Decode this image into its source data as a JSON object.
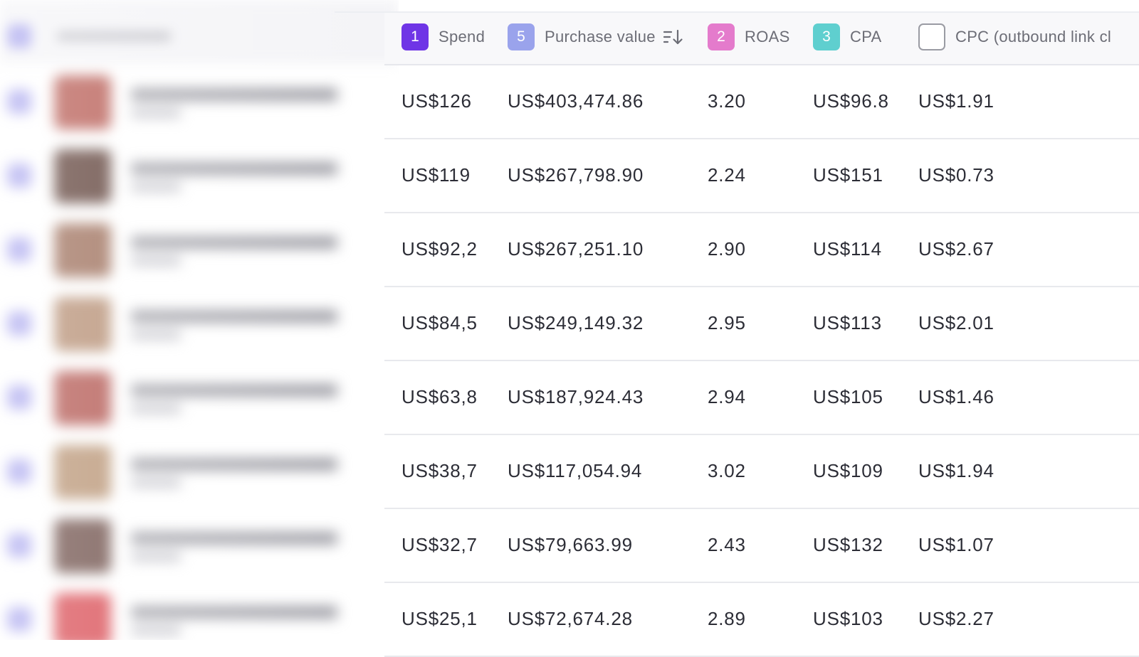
{
  "columns": [
    {
      "badge": "1",
      "label": "Spend",
      "color": "#6f35e6"
    },
    {
      "badge": "5",
      "label": "Purchase value",
      "color": "#9aa3ec",
      "sort_icon": "sort-descending-icon"
    },
    {
      "badge": "2",
      "label": "ROAS",
      "color": "#e47bcc"
    },
    {
      "badge": "3",
      "label": "CPA",
      "color": "#5fcfcf"
    },
    {
      "badge": "",
      "label": "CPC (outbound link cl",
      "color": "#ffffff"
    }
  ],
  "rows": [
    {
      "spend": "US$126",
      "purchase_value": "US$403,474.86",
      "roas": "3.20",
      "cpa": "US$96.8",
      "cpc": "US$1.91"
    },
    {
      "spend": "US$119",
      "purchase_value": "US$267,798.90",
      "roas": "2.24",
      "cpa": "US$151",
      "cpc": "US$0.73"
    },
    {
      "spend": "US$92,2",
      "purchase_value": "US$267,251.10",
      "roas": "2.90",
      "cpa": "US$114",
      "cpc": "US$2.67"
    },
    {
      "spend": "US$84,5",
      "purchase_value": "US$249,149.32",
      "roas": "2.95",
      "cpa": "US$113",
      "cpc": "US$2.01"
    },
    {
      "spend": "US$63,8",
      "purchase_value": "US$187,924.43",
      "roas": "2.94",
      "cpa": "US$105",
      "cpc": "US$1.46"
    },
    {
      "spend": "US$38,7",
      "purchase_value": "US$117,054.94",
      "roas": "3.02",
      "cpa": "US$109",
      "cpc": "US$1.94"
    },
    {
      "spend": "US$32,7",
      "purchase_value": "US$79,663.99",
      "roas": "2.43",
      "cpa": "US$132",
      "cpc": "US$1.07"
    },
    {
      "spend": "US$25,1",
      "purchase_value": "US$72,674.28",
      "roas": "2.89",
      "cpa": "US$103",
      "cpc": "US$2.27"
    }
  ],
  "thumbnail_colors": [
    "#b5564e",
    "#5a3b33",
    "#9a6a55",
    "#b38a6e",
    "#b0504a",
    "#b6906f",
    "#6a4a44",
    "#d8464e"
  ]
}
